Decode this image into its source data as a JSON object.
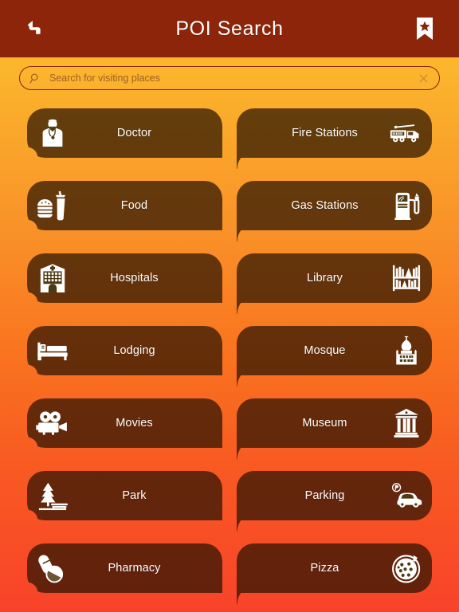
{
  "header": {
    "title": "POI Search",
    "back_icon": "back-arrow-icon",
    "bookmark_icon": "bookmark-star-icon"
  },
  "search": {
    "placeholder": "Search for visiting places",
    "value": "",
    "search_icon": "search-icon",
    "clear_icon": "clear-x-icon"
  },
  "colors": {
    "header_bg": "#8c2509",
    "gradient_top": "#fcc12f",
    "gradient_bottom": "#f8432a",
    "button_fill": "rgba(42,20,2,0.72)",
    "label_text": "#ffffff",
    "search_border": "#8c2509",
    "placeholder_text": "#9c6128"
  },
  "categories": [
    {
      "label": "Doctor",
      "icon": "doctor-icon",
      "column": "left"
    },
    {
      "label": "Fire Stations",
      "icon": "fire-truck-icon",
      "column": "right"
    },
    {
      "label": "Food",
      "icon": "burger-drink-icon",
      "column": "left"
    },
    {
      "label": "Gas Stations",
      "icon": "fuel-pump-icon",
      "column": "right"
    },
    {
      "label": "Hospitals",
      "icon": "hospital-icon",
      "column": "left"
    },
    {
      "label": "Library",
      "icon": "bookshelf-icon",
      "column": "right"
    },
    {
      "label": "Lodging",
      "icon": "bed-icon",
      "column": "left"
    },
    {
      "label": "Mosque",
      "icon": "mosque-dome-icon",
      "column": "right"
    },
    {
      "label": "Movies",
      "icon": "film-camera-icon",
      "column": "left"
    },
    {
      "label": "Museum",
      "icon": "museum-icon",
      "column": "right"
    },
    {
      "label": "Park",
      "icon": "tree-bench-icon",
      "column": "left"
    },
    {
      "label": "Parking",
      "icon": "parking-car-icon",
      "column": "right"
    },
    {
      "label": "Pharmacy",
      "icon": "pills-icon",
      "column": "left"
    },
    {
      "label": "Pizza",
      "icon": "pizza-icon",
      "column": "right"
    }
  ]
}
